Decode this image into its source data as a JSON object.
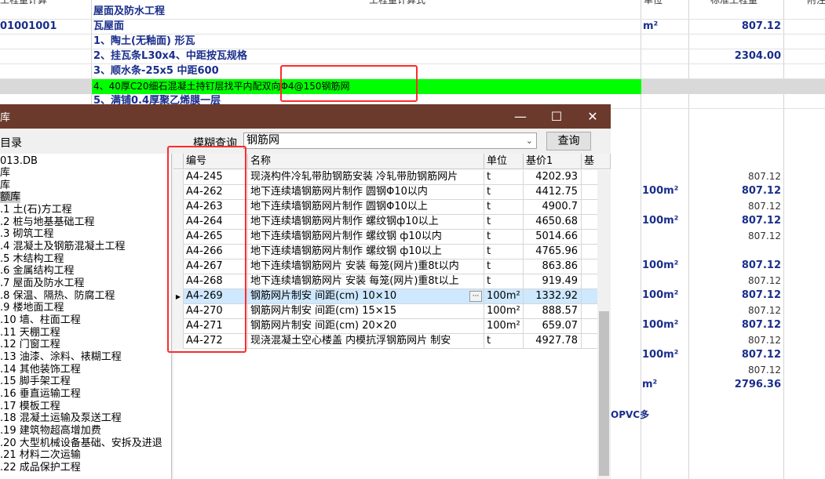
{
  "sheet": {
    "header": {
      "c1": "工程量计算式",
      "c0": "工程量计算",
      "unit": "单位",
      "qty": "标准工程量",
      "extra": "附注"
    },
    "rows": [
      {
        "code": "",
        "name": "屋面及防水工程",
        "unit": "",
        "qty": ""
      },
      {
        "code": "01001001",
        "name": "瓦屋面",
        "unit": "m²",
        "qty": "807.12"
      },
      {
        "code": "",
        "name": "1、陶土(无釉面) 形瓦",
        "unit": "",
        "qty": ""
      },
      {
        "code": "",
        "name": "2、挂瓦条L30x4、中距按瓦规格",
        "unit": "",
        "qty": "2304.00"
      },
      {
        "code": "",
        "name": "3、顺水条-25x5 中距600",
        "unit": "",
        "qty": ""
      },
      {
        "code": "",
        "name": "4、40厚C20细石混凝土持钉层找平内配双向Φ4@150钢筋网",
        "unit": "",
        "qty": ""
      },
      {
        "code": "",
        "name": "5、满铺0.4厚聚乙烯膜一层",
        "unit": "",
        "qty": ""
      }
    ],
    "right_rows": [
      {
        "unit": "",
        "qty": "807.12",
        "bold": false
      },
      {
        "unit": "100m²",
        "qty": "807.12",
        "bold": true
      },
      {
        "unit": "",
        "qty": "807.12",
        "bold": false
      },
      {
        "unit": "100m²",
        "qty": "807.12",
        "bold": true
      },
      {
        "unit": "",
        "qty": "807.12",
        "bold": false
      },
      {
        "unit": "",
        "qty": "",
        "bold": false
      },
      {
        "unit": "100m²",
        "qty": "807.12",
        "bold": true
      },
      {
        "unit": "",
        "qty": "807.12",
        "bold": false
      },
      {
        "unit": "100m²",
        "qty": "807.12",
        "bold": true
      },
      {
        "unit": "",
        "qty": "807.12",
        "bold": false
      },
      {
        "unit": "100m²",
        "qty": "807.12",
        "bold": true
      },
      {
        "unit": "",
        "qty": "807.12",
        "bold": false
      },
      {
        "unit": "100m²",
        "qty": "807.12",
        "bold": true
      },
      {
        "unit": "",
        "qty": "807.12",
        "bold": false
      },
      {
        "unit": "m²",
        "qty": "2796.36",
        "bold": true
      }
    ],
    "partial_text": "OPVC",
    "partial_text_tail": "多"
  },
  "dialog": {
    "title": "库",
    "toolbar": {
      "tree_label": "目录",
      "fuzzy_label": "模糊查询",
      "search_value": "钢筋网",
      "query_button": "查询"
    },
    "tree": [
      "013.DB",
      "库",
      "库",
      "额库",
      ".1 土(石)方工程",
      ".2 桩与地基基础工程",
      ".3 砌筑工程",
      ".4 混凝土及钢筋混凝土工程",
      ".5 木结构工程",
      ".6 金属结构工程",
      ".7 屋面及防水工程",
      ".8 保温、隔热、防腐工程",
      ".9 楼地面工程",
      ".10 墙、柱面工程",
      ".11 天棚工程",
      ".12 门窗工程",
      ".13 油漆、涂料、裱糊工程",
      ".14 其他装饰工程",
      ".15 脚手架工程",
      ".16 垂直运输工程",
      ".17 模板工程",
      ".18 混凝土运输及泵送工程",
      ".19 建筑物超高增加费",
      ".20 大型机械设备基础、安拆及进退",
      ".21 材料二次运输",
      ".22 成品保护工程"
    ],
    "grid": {
      "headers": {
        "code": "编号",
        "name": "名称",
        "unit": "单位",
        "price": "基价1",
        "more": "基"
      },
      "rows": [
        {
          "code": "A4-245",
          "name": "现浇构件冷轧带肋钢筋安装 冷轧带肋钢筋网片",
          "unit": "t",
          "price": "4202.93"
        },
        {
          "code": "A4-262",
          "name": "地下连续墙钢筋网片制作 圆钢Φ10以内",
          "unit": "t",
          "price": "4412.75"
        },
        {
          "code": "A4-263",
          "name": "地下连续墙钢筋网片制作 圆钢Φ10以上",
          "unit": "t",
          "price": "4900.7"
        },
        {
          "code": "A4-264",
          "name": "地下连续墙钢筋网片制作 螺纹钢ф10以上",
          "unit": "t",
          "price": "4650.68"
        },
        {
          "code": "A4-265",
          "name": "地下连续墙钢筋网片制作 螺纹钢 ф10以内",
          "unit": "t",
          "price": "5014.66"
        },
        {
          "code": "A4-266",
          "name": "地下连续墙钢筋网片制作 螺纹钢 ф10以上",
          "unit": "t",
          "price": "4765.96"
        },
        {
          "code": "A4-267",
          "name": "地下连续墙钢筋网片 安装 每笼(网片)重8t以内",
          "unit": "t",
          "price": "863.86"
        },
        {
          "code": "A4-268",
          "name": "地下连续墙钢筋网片 安装 每笼(网片)重8t以上",
          "unit": "t",
          "price": "919.49"
        },
        {
          "code": "A4-269",
          "name": "钢筋网片制安 间距(cm) 10×10",
          "unit": "100m²",
          "price": "1332.92",
          "selected": true
        },
        {
          "code": "A4-270",
          "name": "钢筋网片制安 间距(cm) 15×15",
          "unit": "100m²",
          "price": "888.57"
        },
        {
          "code": "A4-271",
          "name": "钢筋网片制安 间距(cm) 20×20",
          "unit": "100m²",
          "price": "659.07"
        },
        {
          "code": "A4-272",
          "name": "现浇混凝土空心楼盖 内模抗浮钢筋网片 制安",
          "unit": "t",
          "price": "4927.78"
        }
      ],
      "ellipsis": "···",
      "row_marker": "▶"
    },
    "window_buttons": {
      "minimize": "—",
      "maximize": "☐",
      "close": "✕"
    }
  },
  "colors": {
    "title_bar": "#6b3a2c",
    "highlight_row": "#00ff00",
    "annotation_box": "#ff2a2a",
    "selected_row": "#cde8ff"
  }
}
